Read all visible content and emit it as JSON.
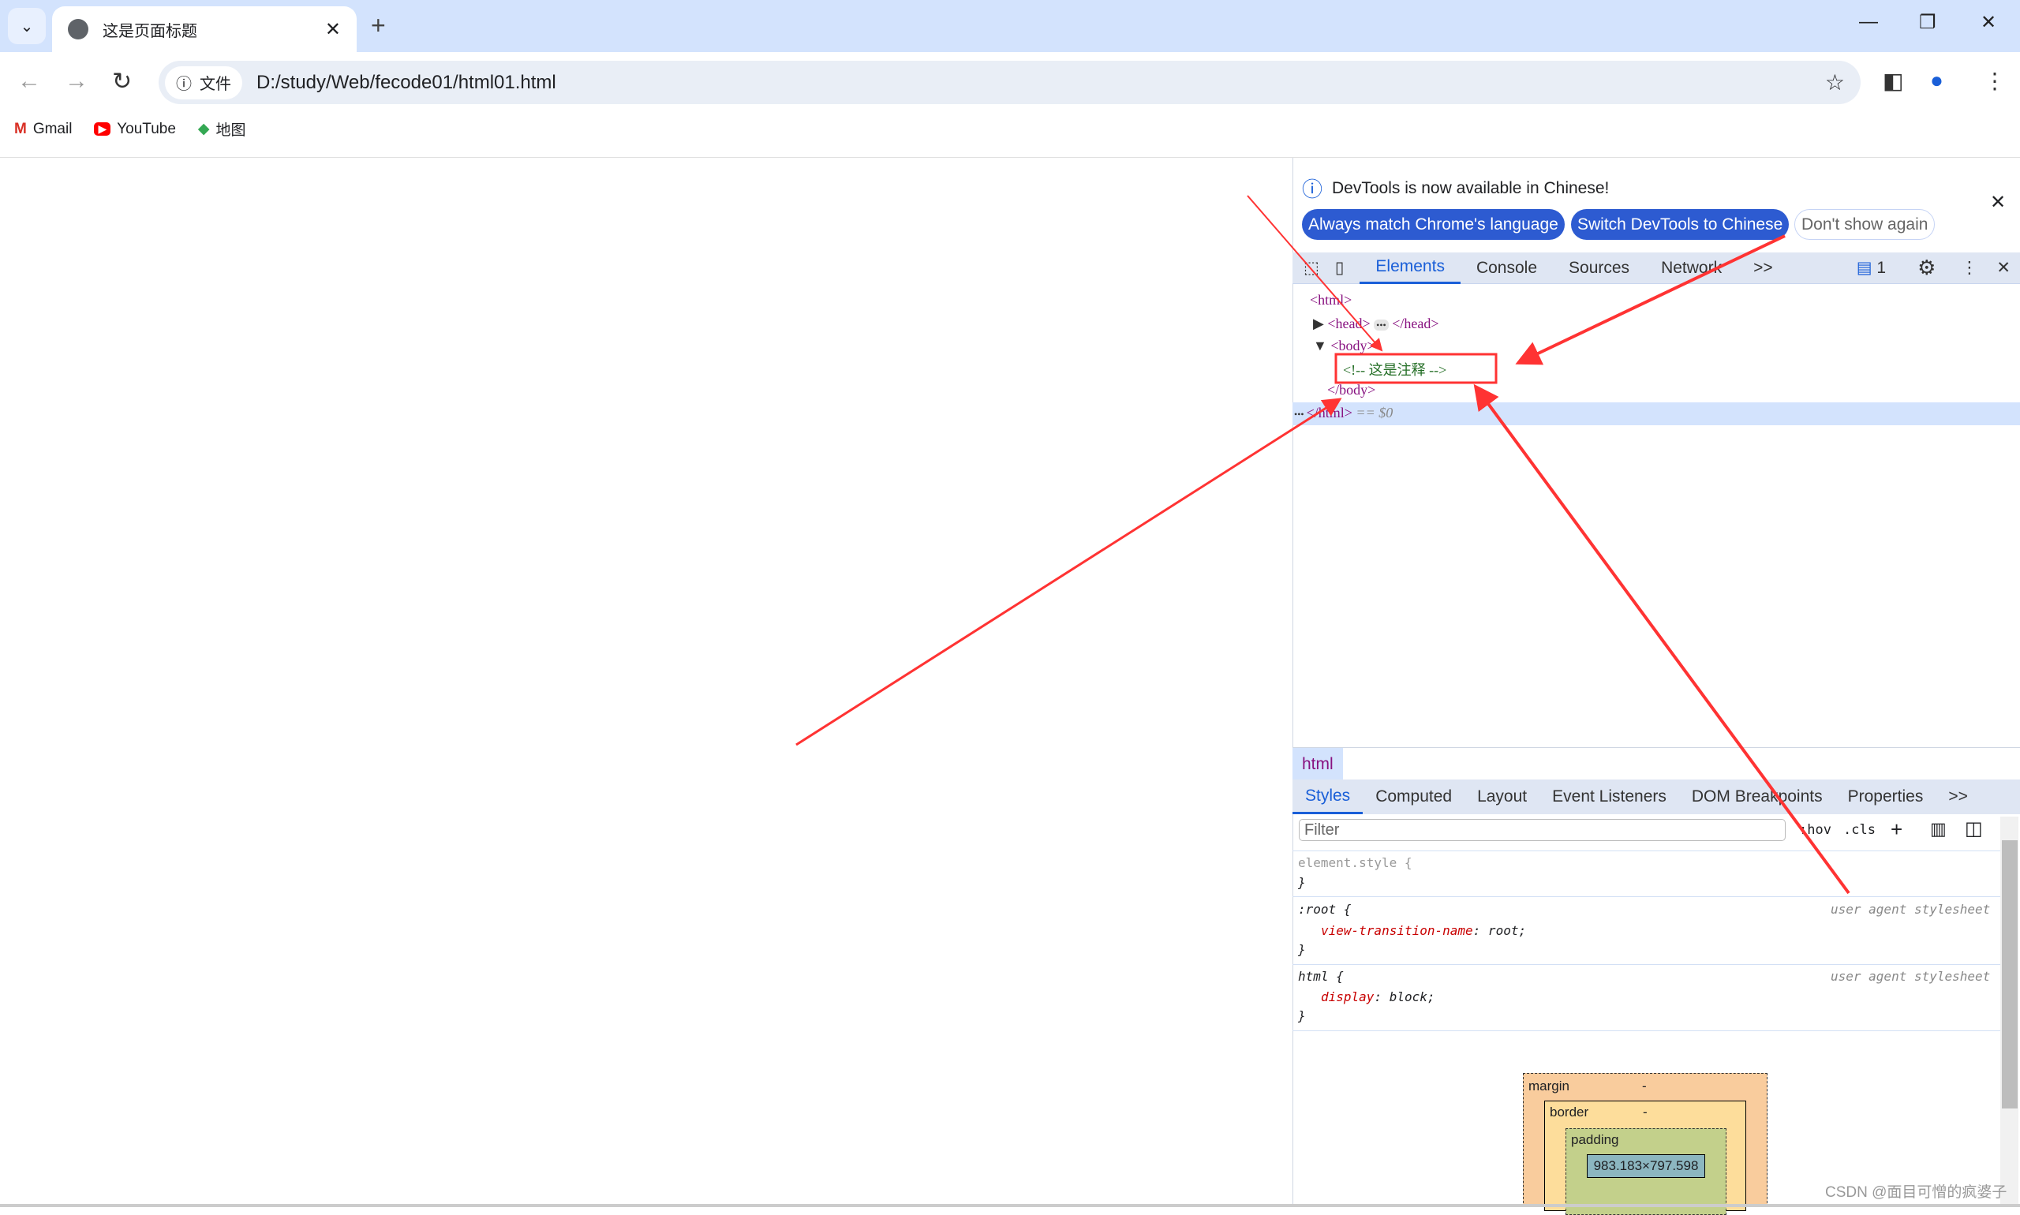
{
  "browser": {
    "tab_title": "这是页面标题",
    "url_chip": "文件",
    "url": "D:/study/Web/fecode01/html01.html",
    "bookmarks": [
      {
        "label": "Gmail"
      },
      {
        "label": "YouTube"
      },
      {
        "label": "地图"
      }
    ]
  },
  "devtools": {
    "infobar": {
      "message": "DevTools is now available in Chinese!",
      "buttons": [
        "Always match Chrome's language",
        "Switch DevTools to Chinese",
        "Don't show again"
      ]
    },
    "tabs": [
      "Elements",
      "Console",
      "Sources",
      "Network",
      ">>"
    ],
    "issues_count": "1",
    "dom": {
      "html_open": "<html>",
      "head": "<head>",
      "head_close": "</head>",
      "body": "<body>",
      "comment": "<!-- 这是注释 -->",
      "body_close": "</body>",
      "html_close": "</html>",
      "selected_suffix": "== $0"
    },
    "breadcrumb": "html",
    "styles_tabs": [
      "Styles",
      "Computed",
      "Layout",
      "Event Listeners",
      "DOM Breakpoints",
      "Properties",
      ">>"
    ],
    "filter_placeholder": "Filter",
    "hov": ":hov",
    "cls": ".cls",
    "rules": [
      {
        "selector": "element.style {",
        "close": "}"
      },
      {
        "selector": ":root {",
        "source": "user agent stylesheet",
        "prop": "view-transition-name",
        "value": " root;",
        "close": "}"
      },
      {
        "selector": "html {",
        "source": "user agent stylesheet",
        "prop": "display",
        "value": " block;",
        "close": "}"
      }
    ],
    "box_model": {
      "margin": "margin",
      "border": "border",
      "padding": "padding",
      "content": "983.183×797.598",
      "dash": "-"
    }
  },
  "watermark": "CSDN @面目可憎的疯婆子",
  "colors": {
    "annotation": "#ff3333",
    "accent": "#1a5fd8"
  }
}
